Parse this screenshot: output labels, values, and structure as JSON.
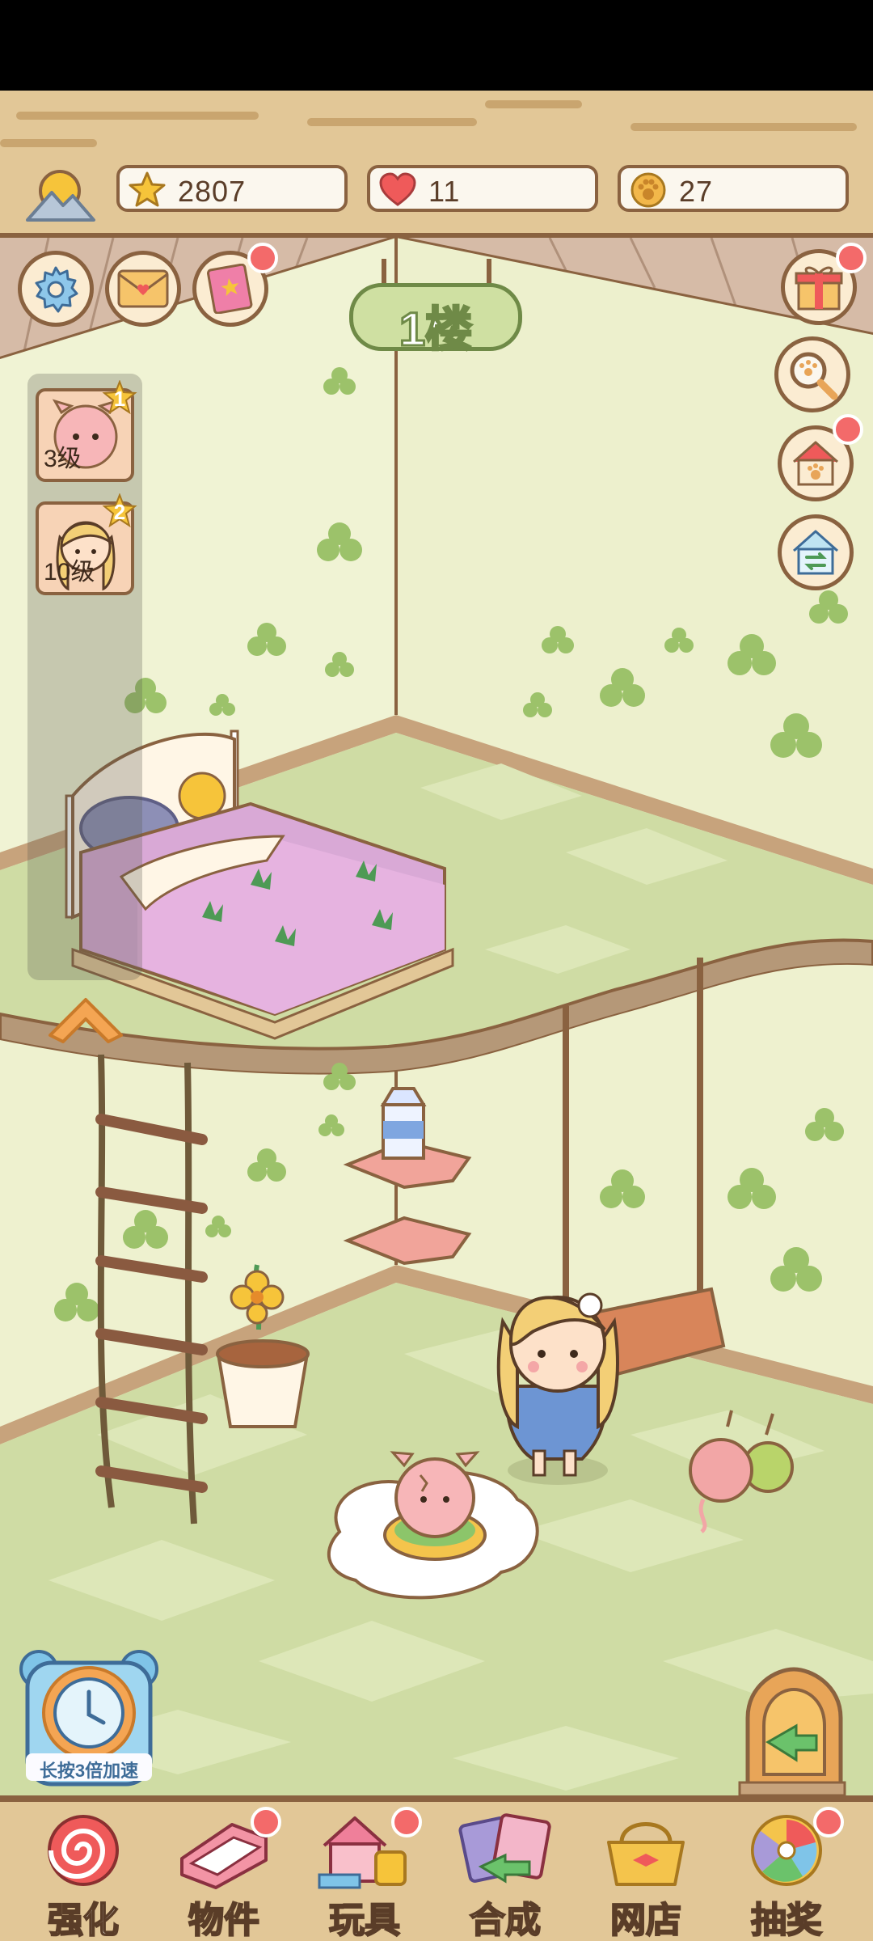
{
  "resources": {
    "stars": "2807",
    "hearts": "11",
    "coins": "27"
  },
  "floor": {
    "label": "1楼"
  },
  "characters": [
    {
      "rank": "1",
      "level": "3级"
    },
    {
      "rank": "2",
      "level": "10级"
    }
  ],
  "speed_button": {
    "label": "长按3倍加速"
  },
  "bottom_nav": [
    {
      "label": "强化"
    },
    {
      "label": "物件"
    },
    {
      "label": "玩具"
    },
    {
      "label": "合成"
    },
    {
      "label": "网店"
    },
    {
      "label": "抽奖"
    }
  ],
  "icons": {
    "weather": "sun-mountain-icon",
    "settings": "gear-icon",
    "mail": "envelope-icon",
    "book": "book-icon",
    "gift": "gift-icon",
    "search": "magnifier-icon",
    "pet_house": "pet-house-icon",
    "swap_house": "house-swap-icon"
  },
  "colors": {
    "wood": "#e2c797",
    "wood_dark": "#8a6240",
    "wall": "#eff2d0",
    "floor": "#cfdca4",
    "badge": "#f36a6a"
  }
}
